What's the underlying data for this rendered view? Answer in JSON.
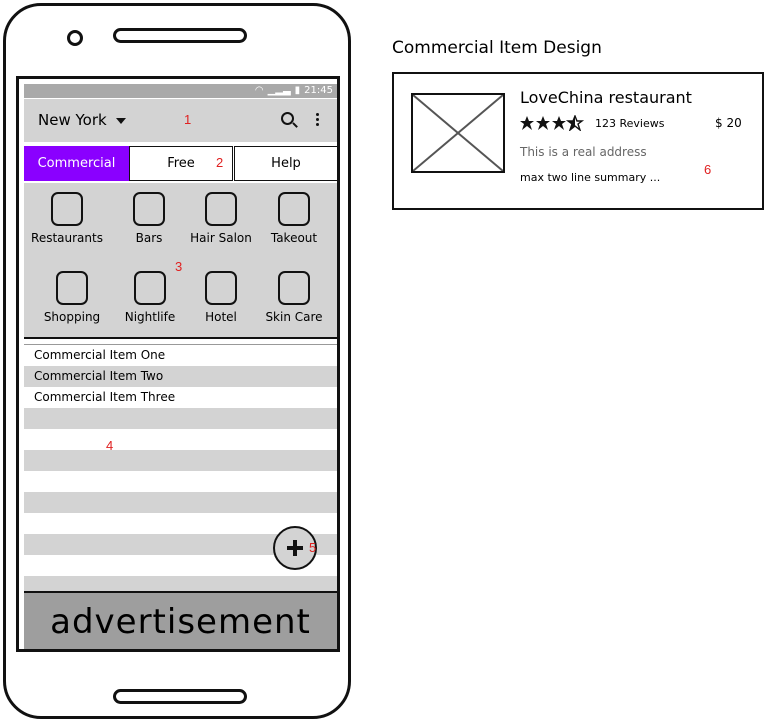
{
  "phone": {
    "status_time": "21:45",
    "city": "New York",
    "tabs": [
      {
        "label": "Commercial",
        "active": true
      },
      {
        "label": "Free",
        "active": false
      },
      {
        "label": "Help",
        "active": false
      }
    ],
    "categories": [
      {
        "label": "Restaurants"
      },
      {
        "label": "Bars"
      },
      {
        "label": "Hair Salon"
      },
      {
        "label": "Takeout"
      },
      {
        "label": "Shopping"
      },
      {
        "label": "Nightlife"
      },
      {
        "label": "Hotel"
      },
      {
        "label": "Skin Care"
      }
    ],
    "list_items": [
      "Commercial Item One",
      "Commercial Item Two",
      "Commercial Item Three"
    ],
    "advertisement": "advertisement"
  },
  "annotations": [
    "1",
    "2",
    "3",
    "4",
    "5",
    "6"
  ],
  "design": {
    "title": "Commercial Item Design",
    "card": {
      "name": "LoveChina restaurant",
      "rating": 3.5,
      "reviews": "123 Reviews",
      "price": "$ 20",
      "address": "This is a real address",
      "summary": "max two line summary ..."
    }
  },
  "colors": {
    "accent": "#8a00ff",
    "panel": "#d3d3d3",
    "annotation": "#e02020",
    "ad_bg": "#9e9e9e"
  },
  "icons": [
    "wifi-icon",
    "signal-icon",
    "battery-icon",
    "dropdown-caret-icon",
    "search-icon",
    "more-vert-icon",
    "plus-icon",
    "image-placeholder-icon",
    "star-icon"
  ]
}
